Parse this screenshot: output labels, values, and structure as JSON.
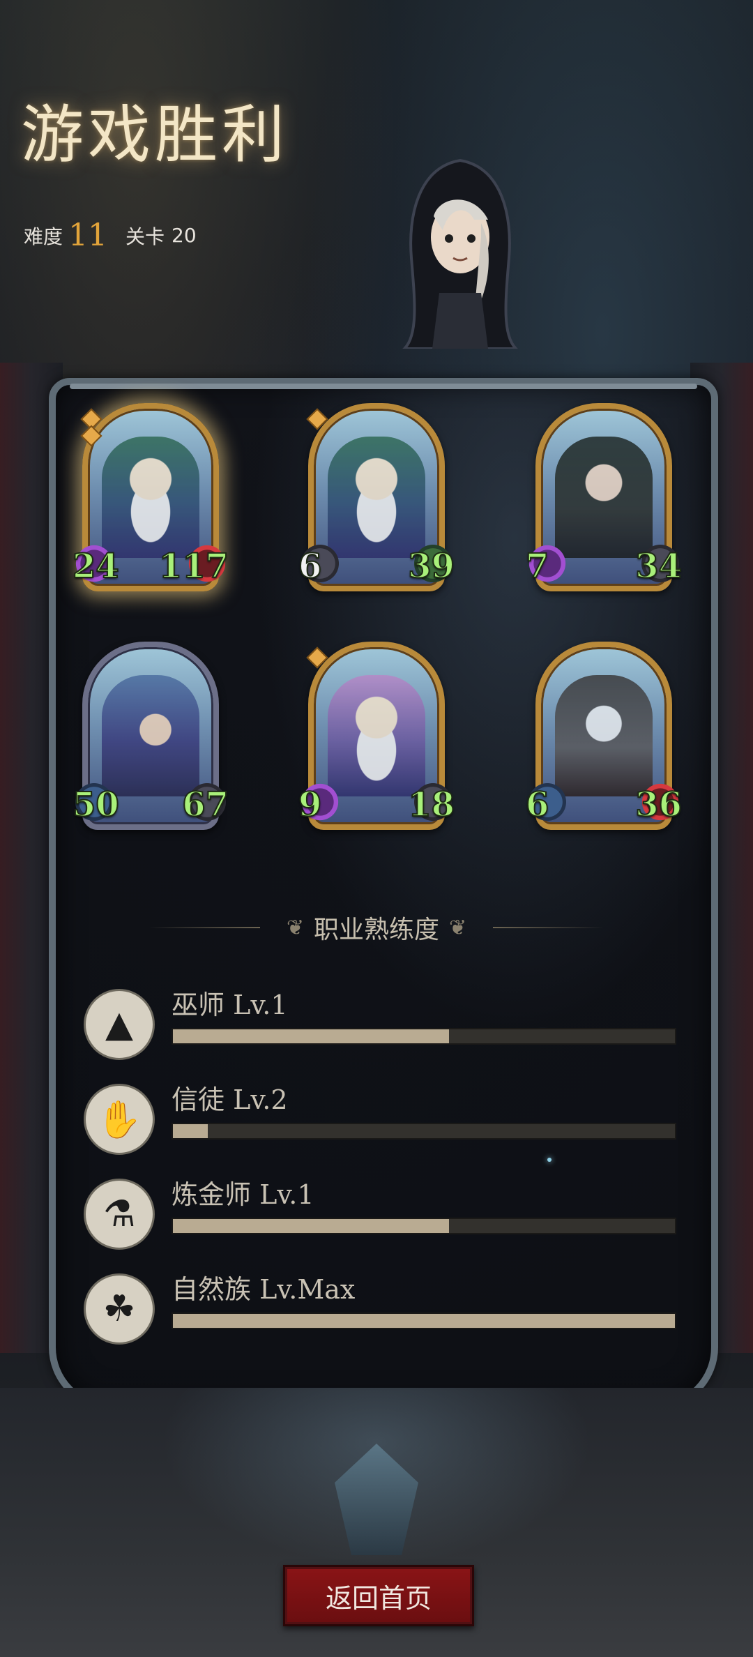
{
  "header": {
    "title": "游戏胜利",
    "difficulty_label": "难度",
    "difficulty_value": "11",
    "stage_label": "关卡",
    "stage_value": "20"
  },
  "cards": [
    {
      "left": "24",
      "right": "117",
      "left_badge": "purple",
      "right_badge": "red"
    },
    {
      "left": "6",
      "right": "39",
      "left_badge": "grey",
      "right_badge": "green"
    },
    {
      "left": "7",
      "right": "34",
      "left_badge": "purple",
      "right_badge": "grey"
    },
    {
      "left": "50",
      "right": "67",
      "left_badge": "blue",
      "right_badge": "grey"
    },
    {
      "left": "9",
      "right": "18",
      "left_badge": "purple",
      "right_badge": "grey"
    },
    {
      "left": "6",
      "right": "36",
      "left_badge": "blue",
      "right_badge": "red"
    }
  ],
  "mastery": {
    "title": "职业熟练度",
    "items": [
      {
        "label": "巫师 Lv.1",
        "icon": "wizard-hat-icon",
        "progress": 0.55
      },
      {
        "label": "信徒 Lv.2",
        "icon": "praying-hands-icon",
        "progress": 0.07
      },
      {
        "label": "炼金师 Lv.1",
        "icon": "alchemy-pot-icon",
        "progress": 0.55
      },
      {
        "label": "自然族 Lv.Max",
        "icon": "nature-beast-icon",
        "progress": 1.0
      }
    ]
  },
  "footer": {
    "home_button": "返回首页"
  },
  "colors": {
    "title_glow": "#f3e6c6",
    "difficulty_accent": "#e2a43a",
    "stat_text": "#a9f07a",
    "button_red": "#8a1416",
    "bar_fill": "#b9ab92"
  }
}
